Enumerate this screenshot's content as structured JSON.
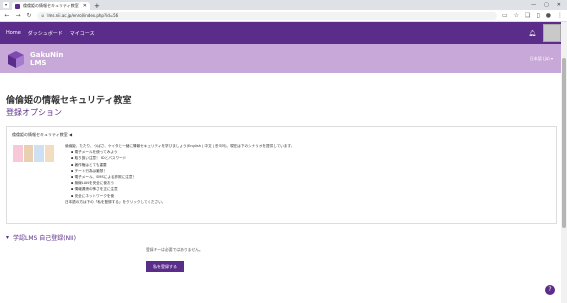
{
  "browser": {
    "tab_title": "倫倫姫の情報セキュリティ教室 | GakuNin LMS",
    "url": "lms.nii.ac.jp/enrol/index.php?id=56"
  },
  "nav": {
    "home": "Home",
    "dashboard": "ダッシュボード",
    "mycourses": "マイコース"
  },
  "hero": {
    "brand_line1": "GakuNin",
    "brand_line2": "LMS",
    "language": "日本語 (ja) ▾"
  },
  "page": {
    "course_title": "倫倫姫の情報セキュリティ教室",
    "subtitle": "登録オプション"
  },
  "course_card": {
    "heading": "倫倫姫の情報セキュリティ教室 ◀",
    "intro": "倫倫姫、たたり、つばさ、ケイタと一緒に情報セキュリティを学びましょう(English | 中文 | 한국어)。現在は下のシナリオを提供しています。",
    "items": [
      "電子メールを使ってみよう",
      "取り扱い注意！ IDとパスワード",
      "著作権はとても重要",
      "チート行為は厳禁！",
      "電子メール、SMSによる詐欺に注意！",
      "無線LANを安全に使おう",
      "情報漏洩の怖さを正に注意",
      "安全にネットワークを使"
    ],
    "footer": "日本語の方は下の「私を登録する」をクリックしてください。"
  },
  "enrol": {
    "section_title": "学認LMS 自己登録(NII)",
    "note": "登録キーは必要ではありません。",
    "button": "私を登録する"
  },
  "help": {
    "label": "?"
  }
}
